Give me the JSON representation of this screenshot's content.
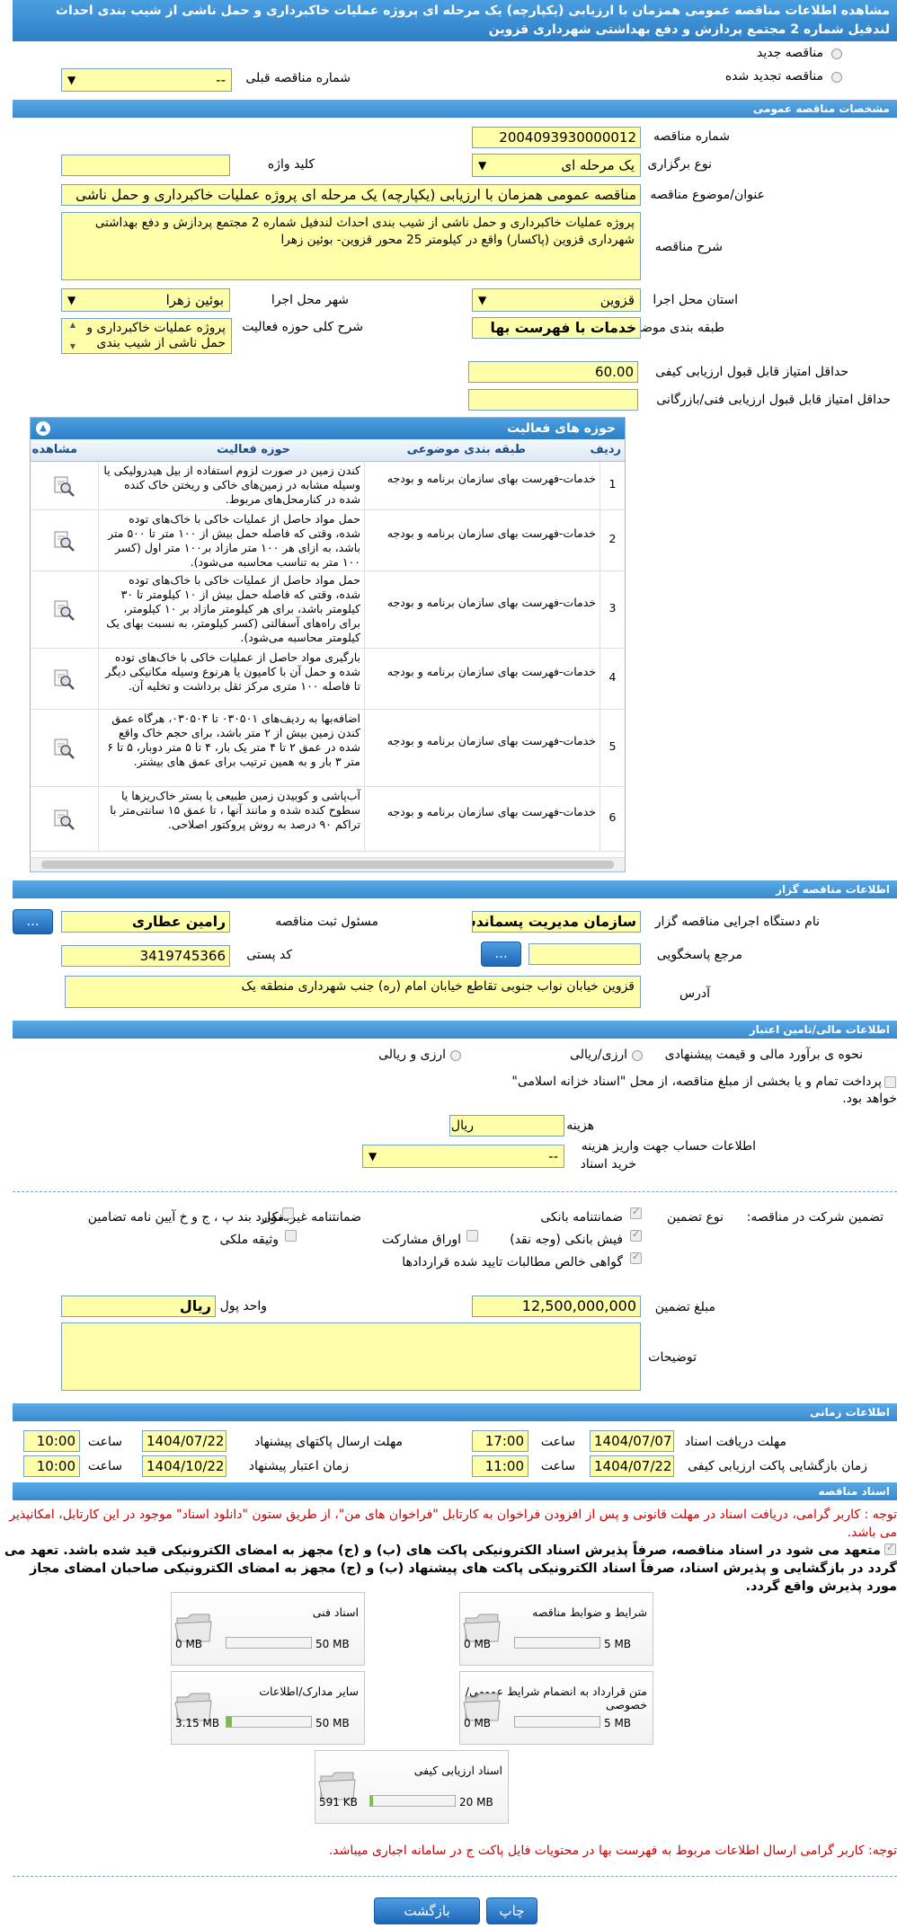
{
  "title_line1": "مشاهده اطلاعات مناقصه عمومی همزمان با ارزیابی (یکپارچه) یک مرحله ای پروژه عملیات خاکبرداری و حمل ناشی از شیب بندی احداث",
  "title_line2": "لندفیل شماره 2 مجتمع پردازش و دفع بهداشتی شهرداری قزوین",
  "new_tender": "مناقصه جدید",
  "renewed_tender": "مناقصه تجدید شده",
  "prev_number_label": "شماره مناقصه قبلی",
  "prev_number_value": "--",
  "sections": {
    "general": "مشخصات مناقصه عمومی",
    "organizer": "اطلاعات مناقصه گزار",
    "financial": "اطلاعات مالی/تامین اعتبار",
    "timing": "اطلاعات زمانی",
    "docs": "اسناد مناقصه"
  },
  "general": {
    "number_label": "شماره مناقصه",
    "number": "2004093930000012",
    "type_label": "نوع برگزاری",
    "type": "یک مرحله ای",
    "keyword_label": "کلید واژه",
    "keyword": "",
    "subject_label": "عنوان/موضوع مناقصه",
    "subject": "مناقصه عمومی همزمان با ارزیابی (یکپارچه) یک مرحله ای پروژه عملیات خاکبرداری و حمل ناشی",
    "desc_label": "شرح مناقصه",
    "desc": "پروژه عملیات خاکبرداری و حمل ناشی از شیب بندی احداث لندفیل شماره 2 مجتمع پردازش و دفع بهداشتی شهرداری قزوین (پاکسار) واقع در کیلومتر 25 محور قزوین- بوئین زهرا",
    "province_label": "استان محل اجرا",
    "province": "قزوین",
    "city_label": "شهر محل اجرا",
    "city": "بوئین زهرا",
    "category_label": "طبقه بندی موضوعی",
    "category": "خدمات با فهرست بها",
    "scope_label": "شرح کلی حوزه فعالیت",
    "scope": "پروژه عملیات خاکبرداری و حمل ناشی از شیب بندی",
    "min_quality_label": "حداقل امتیاز قابل قبول ارزیابی کیفی",
    "min_quality": "60.00",
    "min_tech_label": "حداقل امتیاز قابل قبول ارزیابی فنی/بازرگانی",
    "min_tech": ""
  },
  "grid": {
    "title": "حوزه های فعالیت",
    "headers": {
      "row": "ردیف",
      "category": "طبقه بندی موضوعی",
      "scope": "حوزه فعالیت",
      "view": "مشاهده"
    },
    "rows": [
      {
        "n": "1",
        "cat": "خدمات-فهرست بهای سازمان برنامه و بودجه",
        "scope": "کندن زمین در صورت لزوم استفاده از بیل هیدرولیکی یا وسیله مشابه در زمین‌های خاکی و ریختن خاک کنده شده در کنارمحل‌های مربوط."
      },
      {
        "n": "2",
        "cat": "خدمات-فهرست بهای سازمان برنامه و بودجه",
        "scope": "حمل مواد حاصل از عملیات خاکی با خاک‌های توده شده، وقتی که فاصله حمل بیش از ۱۰۰ متر تا ۵۰۰ متر باشد، به ازای هر ۱۰۰ متر مازاد بر۱۰۰ متر اول (کسر ۱۰۰ متر به تناسب محاسبه می‌شود)."
      },
      {
        "n": "3",
        "cat": "خدمات-فهرست بهای سازمان برنامه و بودجه",
        "scope": "حمل مواد حاصل از عملیات خاکی با خاک‌های توده شده، وقتی که فاصله حمل بیش از ۱۰ کیلومتر تا ۳۰ کیلومتر باشد، برای هر کیلومتر مازاد بر ۱۰ کیلومتر، برای راه‌های آسفالتی (کسر کیلومتر، به نسبت بهای یک کیلومتر محاسبه می‌شود)."
      },
      {
        "n": "4",
        "cat": "خدمات-فهرست بهای سازمان برنامه و بودجه",
        "scope": "بارگیری مواد حاصل از عملیات خاکی با خاک‌های توده شده و حمل آن با کامیون یا هرنوع وسیله مکانیکی دیگر تا فاصله ۱۰۰ متری مرکز ثقل برداشت و تخلیه آن."
      },
      {
        "n": "5",
        "cat": "خدمات-فهرست بهای سازمان برنامه و بودجه",
        "scope": "اضافه‌بها به ردیف‌های ۰۳۰۵۰۱ تا ۰۳۰۵۰۴، هرگاه عمق کندن زمین بیش از ۲ متر باشد، برای حجم خاک واقع شده در عمق ۲ تا ۴ متر یک بار، ۴ تا ۵ متر دوبار، ۵ تا ۶ متر ۳ بار و به همین ترتیب برای عمق های بیشتر."
      },
      {
        "n": "6",
        "cat": "خدمات-فهرست بهای سازمان برنامه و بودجه",
        "scope": "آب‌پاشی و کوبیدن زمین طبیعی یا بستر خاک‌ریزها یا سطوح کنده شده و مانند آنها ، تا عمق ۱۵ سانتی‌متر با تراکم ۹۰ درصد به روش پروکتور اصلاحی."
      }
    ]
  },
  "organizer": {
    "org_label": "نام دستگاه اجرایی مناقصه گزار",
    "org": "سازمان مدیریت پسماندشهر",
    "resp_label": "مسئول ثبت مناقصه",
    "resp": "رامین عطاری",
    "ref_label": "مرجع پاسخگویی",
    "ref": "",
    "postal_label": "کد پستی",
    "postal": "3419745366",
    "addr_label": "آدرس",
    "addr": "قزوین خیابان نواب جنوبی تقاطع خیابان امام (ره) جنب شهرداری منطقه یک",
    "more": "...",
    "more2": "..."
  },
  "financial": {
    "estimate_label": "نحوه ی برآورد مالی و قیمت پیشنهادی",
    "opt_rial": "ارزی/ریالی",
    "opt_both": "ارزی و ریالی",
    "treasury_l1": "پرداخت تمام و یا بخشی از مبلغ مناقصه، از محل \"اسناد خزانه اسلامی\"",
    "treasury_l2": "خواهد بود.",
    "doc_cost_label": "هزینه خرید اسناد",
    "doc_cost": "",
    "doc_cost_unit": "ریال",
    "account_label_1": "اطلاعات حساب جهت واریز هزینه",
    "account_label_2": "خرید اسناد",
    "account": "--",
    "guarantee_label": "تضمین شرکت در مناقصه:",
    "guarantee_type_label": "نوع تضمین",
    "g1": "ضمانتنامه بانکی",
    "g2": "ضمانتنامه غیربانکی",
    "g3": "موارد بند پ ، ج و خ آیین نامه تضامین",
    "g4": "فیش بانکی (وجه نقد)",
    "g5": "اوراق مشارکت",
    "g6": "وثیقه ملکی",
    "g7": "گواهی خالص مطالبات تایید شده قراردادها",
    "amount_label": "مبلغ تضمین",
    "amount": "12,500,000,000",
    "currency_label": "واحد پول",
    "currency": "ریال",
    "notes_label": "توضیحات",
    "notes": ""
  },
  "timing": {
    "recv_label": "مهلت دریافت اسناد",
    "recv_date": "1404/07/07",
    "recv_time": "17:00",
    "send_label": "مهلت ارسال پاکتهای پیشنهاد",
    "send_date": "1404/07/22",
    "send_time": "10:00",
    "open_label": "زمان بازگشایی پاکت ارزیابی کیفی",
    "open_date": "1404/07/22",
    "open_time": "11:00",
    "valid_label": "زمان اعتبار پیشنهاد",
    "valid_date": "1404/10/22",
    "valid_time": "10:00",
    "time_label": "ساعت"
  },
  "docs": {
    "note1": "توجه : کاربر گرامی، دریافت اسناد در مهلت قانونی و پس از افزودن فراخوان به کارتابل \"فراخوان های من\"، از طریق ستون \"دانلود اسناد\" موجود در این کارتابل، امکانپذیر می باشد.",
    "commit": "متعهد می شود در اسناد مناقصه، صرفاً پذیرش اسناد الکترونیکی پاکت های (ب) و (ج) مجهز به امضای الکترونیکی قید شده باشد. تعهد می گردد در بازگشایی و پذیرش اسناد، صرفاً اسناد الکترونیکی پاکت های پیشنهاد (ب) و (ج) مجهز به امضای الکترونیکی صاحبان امضای مجاز مورد پذیرش واقع گردد.",
    "files": [
      {
        "name": "شرایط و ضوابط مناقصه",
        "used": "0 MB",
        "max": "5 MB",
        "pct": 0
      },
      {
        "name": "اسناد فنی",
        "used": "0 MB",
        "max": "50 MB",
        "pct": 0
      },
      {
        "name": "متن قرارداد به انضمام شرایط عمومی/خصوصی",
        "used": "0 MB",
        "max": "5 MB",
        "pct": 0
      },
      {
        "name": "سایر مدارک/اطلاعات",
        "used": "3.15 MB",
        "max": "50 MB",
        "pct": 0.063
      },
      {
        "name": "اسناد ارزیابی کیفی",
        "used": "591 KB",
        "max": "20 MB",
        "pct": 0.029
      }
    ],
    "note2": "توجه: کاربر گرامی ارسال اطلاعات مربوط به فهرست بها در محتویات فایل پاکت ج در سامانه اجباری میباشد."
  },
  "buttons": {
    "print": "چاپ",
    "back": "بازگشت"
  },
  "colors": {
    "accent": "#2f7fc6",
    "field": "#ffffaa",
    "warn": "#cc0000"
  }
}
